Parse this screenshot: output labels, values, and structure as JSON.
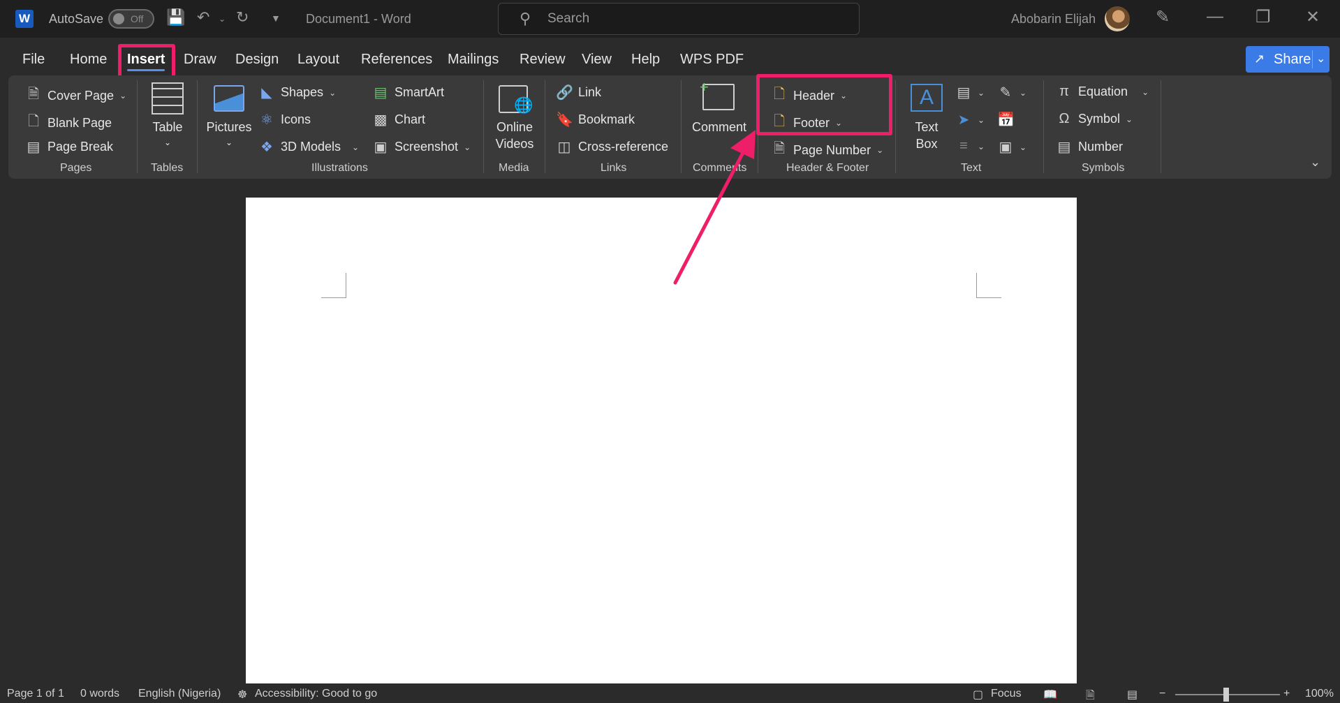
{
  "titlebar": {
    "logo": "W",
    "autosave_label": "AutoSave",
    "autosave_state": "Off",
    "doc_title": "Document1  -  Word",
    "search_placeholder": "Search",
    "user_name": "Abobarin Elijah"
  },
  "menu": {
    "tabs": [
      "File",
      "Home",
      "Insert",
      "Draw",
      "Design",
      "Layout",
      "References",
      "Mailings",
      "Review",
      "View",
      "Help",
      "WPS PDF"
    ],
    "active": "Insert",
    "share_label": "Share"
  },
  "ribbon": {
    "pages": {
      "cover_page": "Cover Page",
      "blank_page": "Blank Page",
      "page_break": "Page Break",
      "group": "Pages"
    },
    "tables": {
      "table": "Table",
      "group": "Tables"
    },
    "illustrations": {
      "pictures": "Pictures",
      "shapes": "Shapes",
      "icons": "Icons",
      "models": "3D Models",
      "smartart": "SmartArt",
      "chart": "Chart",
      "screenshot": "Screenshot",
      "group": "Illustrations"
    },
    "media": {
      "online_videos_1": "Online",
      "online_videos_2": "Videos",
      "group": "Media"
    },
    "links": {
      "link": "Link",
      "bookmark": "Bookmark",
      "cross_reference": "Cross-reference",
      "group": "Links"
    },
    "comments": {
      "comment": "Comment",
      "group": "Comments"
    },
    "header_footer": {
      "header": "Header",
      "footer": "Footer",
      "page_number": "Page Number",
      "group": "Header & Footer"
    },
    "text": {
      "text_box_1": "Text",
      "text_box_2": "Box",
      "group": "Text"
    },
    "symbols": {
      "equation": "Equation",
      "symbol": "Symbol",
      "number": "Number",
      "group": "Symbols"
    }
  },
  "status": {
    "page": "Page 1 of 1",
    "words": "0 words",
    "language": "English (Nigeria)",
    "accessibility": "Accessibility: Good to go",
    "focus": "Focus",
    "zoom": "100%"
  },
  "colors": {
    "highlight": "#ee1e68",
    "accent": "#3a7be8"
  }
}
